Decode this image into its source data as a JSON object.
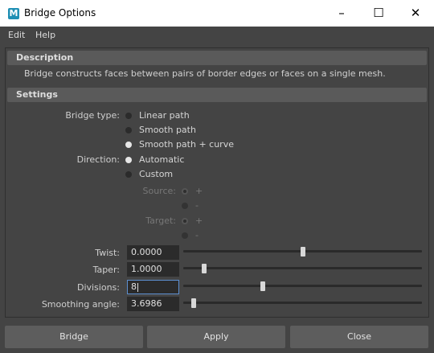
{
  "window": {
    "icon_letter": "M",
    "title": "Bridge Options",
    "minimize": "–",
    "maximize": "☐",
    "close": "✕"
  },
  "menu": [
    "Edit",
    "Help"
  ],
  "description": {
    "header": "Description",
    "text": "Bridge constructs faces between pairs of border edges or faces on a single mesh."
  },
  "settings": {
    "header": "Settings",
    "bridge_type": {
      "label": "Bridge type:",
      "options": [
        "Linear path",
        "Smooth path",
        "Smooth path + curve"
      ],
      "selected": "Smooth path + curve"
    },
    "direction": {
      "label": "Direction:",
      "options": [
        "Automatic",
        "Custom"
      ],
      "selected": "Automatic"
    },
    "source": {
      "label": "Source:",
      "options": [
        "+",
        "-"
      ]
    },
    "target": {
      "label": "Target:",
      "options": [
        "+",
        "-"
      ]
    },
    "twist": {
      "label": "Twist:",
      "value": "0.0000",
      "slider_fraction": 0.5
    },
    "taper": {
      "label": "Taper:",
      "value": "1.0000",
      "slider_fraction": 0.08
    },
    "divisions": {
      "label": "Divisions:",
      "value": "8",
      "slider_fraction": 0.33
    },
    "smoothing_angle": {
      "label": "Smoothing angle:",
      "value": "3.6986",
      "slider_fraction": 0.035
    }
  },
  "buttons": {
    "bridge": "Bridge",
    "apply": "Apply",
    "close": "Close"
  },
  "colors": {
    "background": "#444444",
    "section_header": "#5a5a5a",
    "field_bg": "#2b2b2b",
    "active_border": "#5d8fd0",
    "button_bg": "#5d5d5d"
  }
}
